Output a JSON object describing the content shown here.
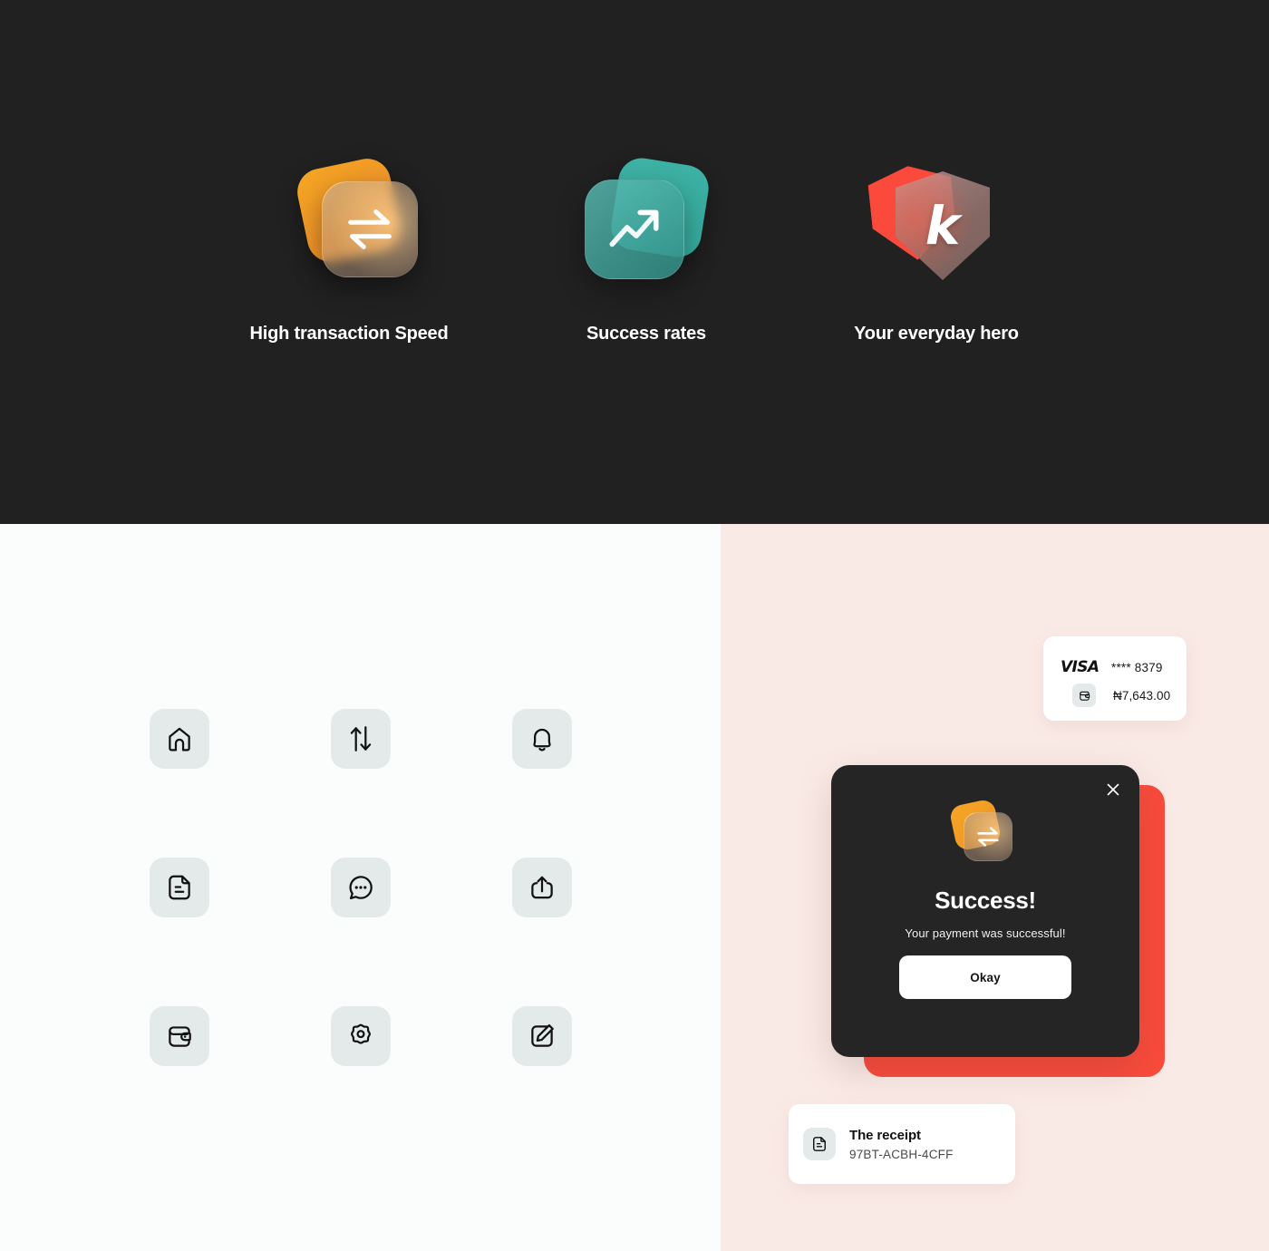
{
  "hero": {
    "background_color": "#212121",
    "features": [
      {
        "label": "High transaction Speed",
        "icon": "exchange-arrows-icon",
        "accent": "#f0952a"
      },
      {
        "label": "Success rates",
        "icon": "trending-up-arrow-icon",
        "accent": "#35a99d"
      },
      {
        "label": "Your everyday hero",
        "icon": "shield-k-logo-icon",
        "accent": "#fb4a3b",
        "glyph": "k"
      }
    ]
  },
  "icon_library": {
    "background_color": "#fbfcfc",
    "tile_color": "#e3eae9",
    "icons": [
      {
        "name": "home-icon"
      },
      {
        "name": "transfer-up-down-icon"
      },
      {
        "name": "bell-notification-icon"
      },
      {
        "name": "document-receipt-icon"
      },
      {
        "name": "chat-bubble-icon"
      },
      {
        "name": "share-upload-icon"
      },
      {
        "name": "wallet-icon"
      },
      {
        "name": "settings-gear-icon"
      },
      {
        "name": "edit-pencil-icon"
      }
    ]
  },
  "showcase": {
    "background_color": "#faeae6",
    "card": {
      "brand": "VISA",
      "masked_number": "**** 8379",
      "amount": "₦7,643.00",
      "wallet_icon": "wallet-icon"
    },
    "modal": {
      "background_color": "#252525",
      "shadow_card_color": "#f94b3c",
      "close_icon": "close-x-icon",
      "brand_icon": "exchange-arrows-icon",
      "title": "Success!",
      "subtitle": "Your payment was successful!",
      "button_label": "Okay"
    },
    "receipt": {
      "icon": "document-receipt-icon",
      "title": "The receipt",
      "code": "97BT-ACBH-4CFF"
    }
  }
}
